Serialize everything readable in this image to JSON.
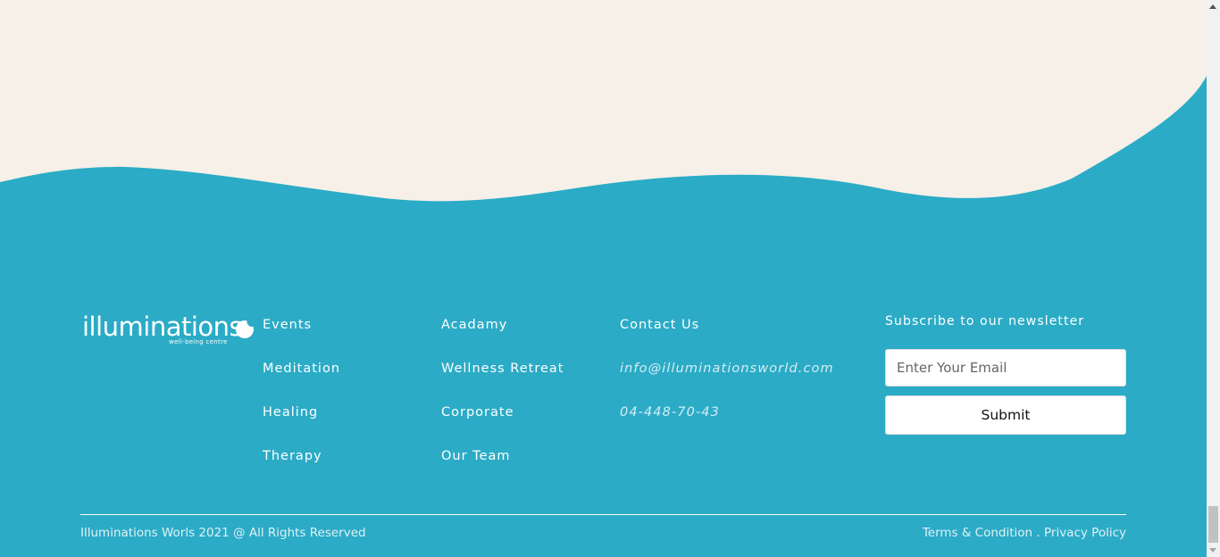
{
  "colors": {
    "background_top": "#f7f0e8",
    "footer": "#2babc6",
    "text": "#ffffff"
  },
  "logo": {
    "name": "illuminations",
    "tagline": "well-being centre"
  },
  "footer": {
    "column1": [
      "Events",
      "Meditation",
      "Healing",
      "Therapy"
    ],
    "column2": [
      "Acadamy",
      "Wellness Retreat",
      "Corporate",
      "Our Team"
    ],
    "contact": {
      "heading": "Contact Us",
      "email": "info@illuminationsworld.com",
      "phone": "04-448-70-43"
    },
    "newsletter": {
      "heading": "Subscribe to our newsletter",
      "placeholder": "Enter Your Email",
      "button": "Submit"
    },
    "copyright": "Illuminations Worls 2021 @ All Rights Reserved",
    "terms": "Terms & Condition",
    "separator": " . ",
    "privacy": "Privacy Policy"
  }
}
